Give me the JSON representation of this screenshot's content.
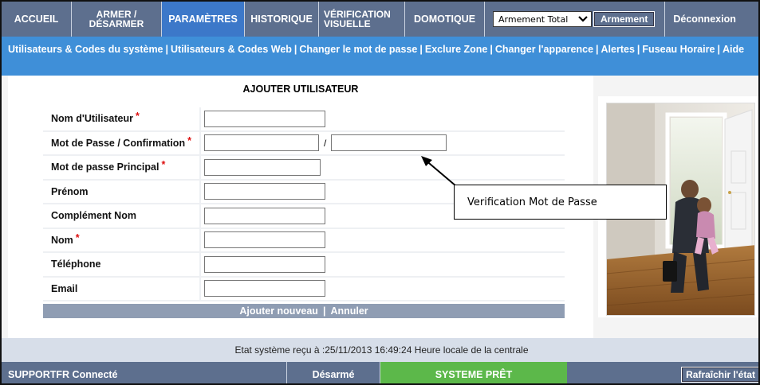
{
  "topnav": {
    "items": [
      {
        "label": "ACCUEIL"
      },
      {
        "line1": "ARMER /",
        "line2": "DÉSARMER"
      },
      {
        "label": "PARAMÈTRES"
      },
      {
        "label": "HISTORIQUE"
      },
      {
        "line1": "VÉRIFICATION",
        "line2": "VISUELLE"
      },
      {
        "label": "DOMOTIQUE"
      }
    ],
    "arm_mode_value": "Armement Total",
    "arm_button": "Armement",
    "logout": "Déconnexion"
  },
  "subnav": {
    "links": [
      "Utilisateurs & Codes du système",
      "Utilisateurs & Codes Web",
      "Changer le mot de passe",
      "Exclure Zone",
      "Changer l'apparence",
      "Alertes",
      "Fuseau Horaire",
      "Aide"
    ]
  },
  "form": {
    "title": "AJOUTER UTILISATEUR",
    "fields": [
      {
        "label": "Nom d'Utilisateur",
        "required": "*"
      },
      {
        "label": "Mot de Passe / Confirmation",
        "required": "*",
        "separator": "/"
      },
      {
        "label": "Mot de passe Principal",
        "required": "*"
      },
      {
        "label": "Prénom",
        "required": ""
      },
      {
        "label": "Complément Nom",
        "required": ""
      },
      {
        "label": "Nom",
        "required": "*"
      },
      {
        "label": "Téléphone",
        "required": ""
      },
      {
        "label": "Email",
        "required": ""
      }
    ],
    "add_new": "Ajouter nouveau",
    "cancel": "Annuler",
    "action_separator": "|"
  },
  "callout": {
    "text": "Verification Mot de Passe"
  },
  "status": {
    "line": "Etat système reçu à :25/11/2013 16:49:24 Heure locale de la centrale"
  },
  "footer": {
    "user": "SUPPORTFR Connecté",
    "state": "Désarmé",
    "ready": "SYSTEME PRÊT",
    "refresh": "Rafraîchir l'état"
  },
  "colors": {
    "nav_bg": "#5d6f8e",
    "nav_active": "#3c78c9",
    "subnav_bg": "#3f8fd8",
    "ready_green": "#5cb84a",
    "required_red": "#d11111"
  }
}
